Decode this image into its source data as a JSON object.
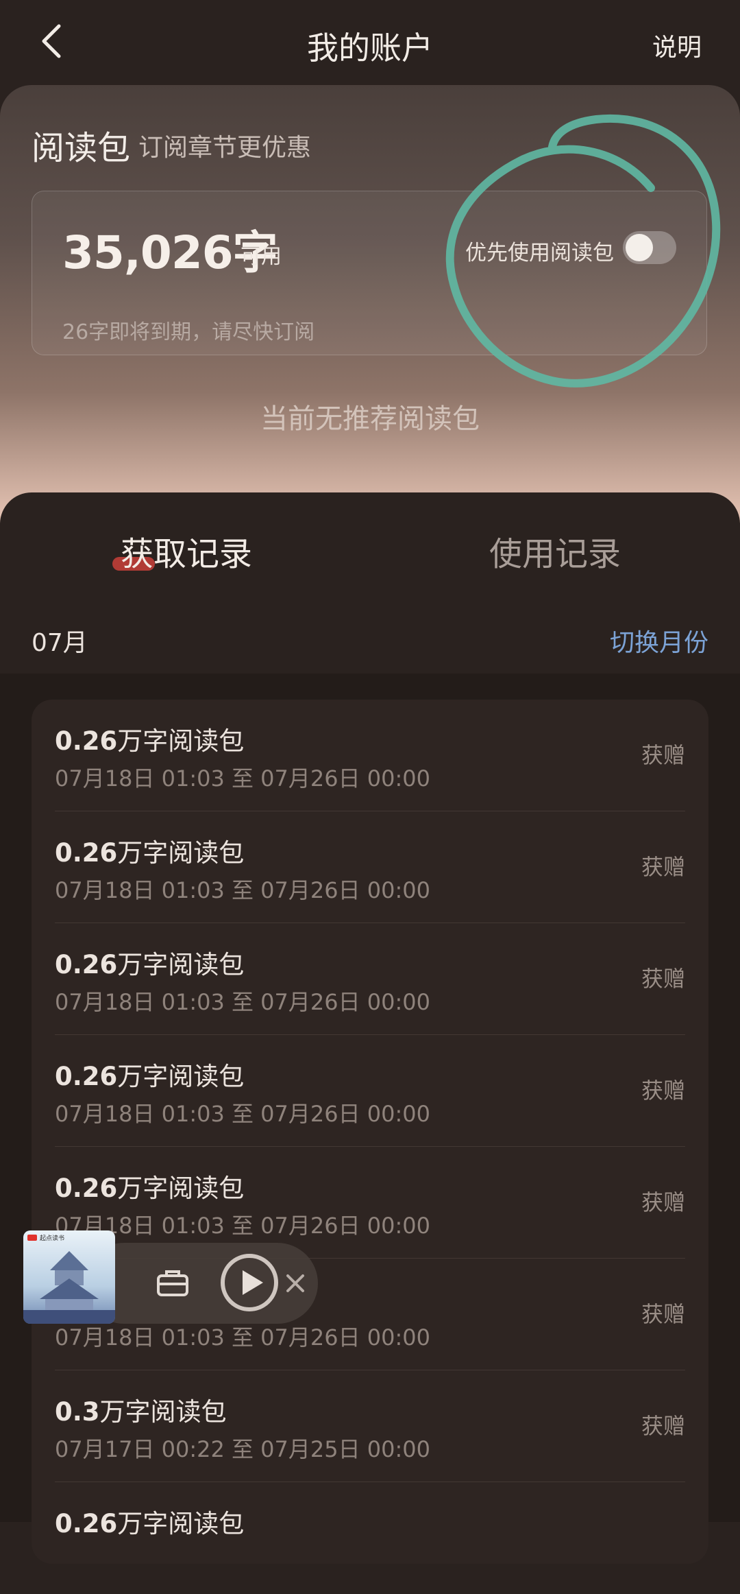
{
  "header": {
    "title": "我的账户",
    "help": "说明"
  },
  "package": {
    "title": "阅读包",
    "subtitle": "订阅章节更优惠",
    "balance": "35,026字",
    "balance_unit": "可用",
    "toggle_label": "优先使用阅读包",
    "toggle_on": false,
    "expire_note": "26字即将到期，请尽快订阅",
    "no_recommend": "当前无推荐阅读包"
  },
  "tabs": [
    {
      "label": "获取记录",
      "active": true
    },
    {
      "label": "使用记录",
      "active": false
    }
  ],
  "filter": {
    "month": "07月",
    "switch_label": "切换月份"
  },
  "records": [
    {
      "amount": "0.26",
      "unit_text": "万字阅读包",
      "period": "07月18日 01:03 至 07月26日 00:00",
      "type": "获赠"
    },
    {
      "amount": "0.26",
      "unit_text": "万字阅读包",
      "period": "07月18日 01:03 至 07月26日 00:00",
      "type": "获赠"
    },
    {
      "amount": "0.26",
      "unit_text": "万字阅读包",
      "period": "07月18日 01:03 至 07月26日 00:00",
      "type": "获赠"
    },
    {
      "amount": "0.26",
      "unit_text": "万字阅读包",
      "period": "07月18日 01:03 至 07月26日 00:00",
      "type": "获赠"
    },
    {
      "amount": "0.26",
      "unit_text": "万字阅读包",
      "period": "07月18日 01:03 至 07月26日 00:00",
      "type": "获赠"
    },
    {
      "amount": "",
      "unit_text": "",
      "period": "07月18日 01:03 至 07月26日 00:00",
      "type": "获赠"
    },
    {
      "amount": "0.3",
      "unit_text": "万字阅读包",
      "period": "07月17日 00:22 至 07月25日 00:00",
      "type": "获赠"
    },
    {
      "amount": "0.26",
      "unit_text": "万字阅读包",
      "period": "",
      "type": ""
    }
  ],
  "mini_player": {
    "cover_badge": "起点读书",
    "icons": [
      "bookshelf-icon",
      "play-icon",
      "close-icon"
    ]
  },
  "colors": {
    "accent_blue": "#7ca3d6",
    "tab_indicator": "#c9403a",
    "annotation_green": "#5fb8a3"
  }
}
